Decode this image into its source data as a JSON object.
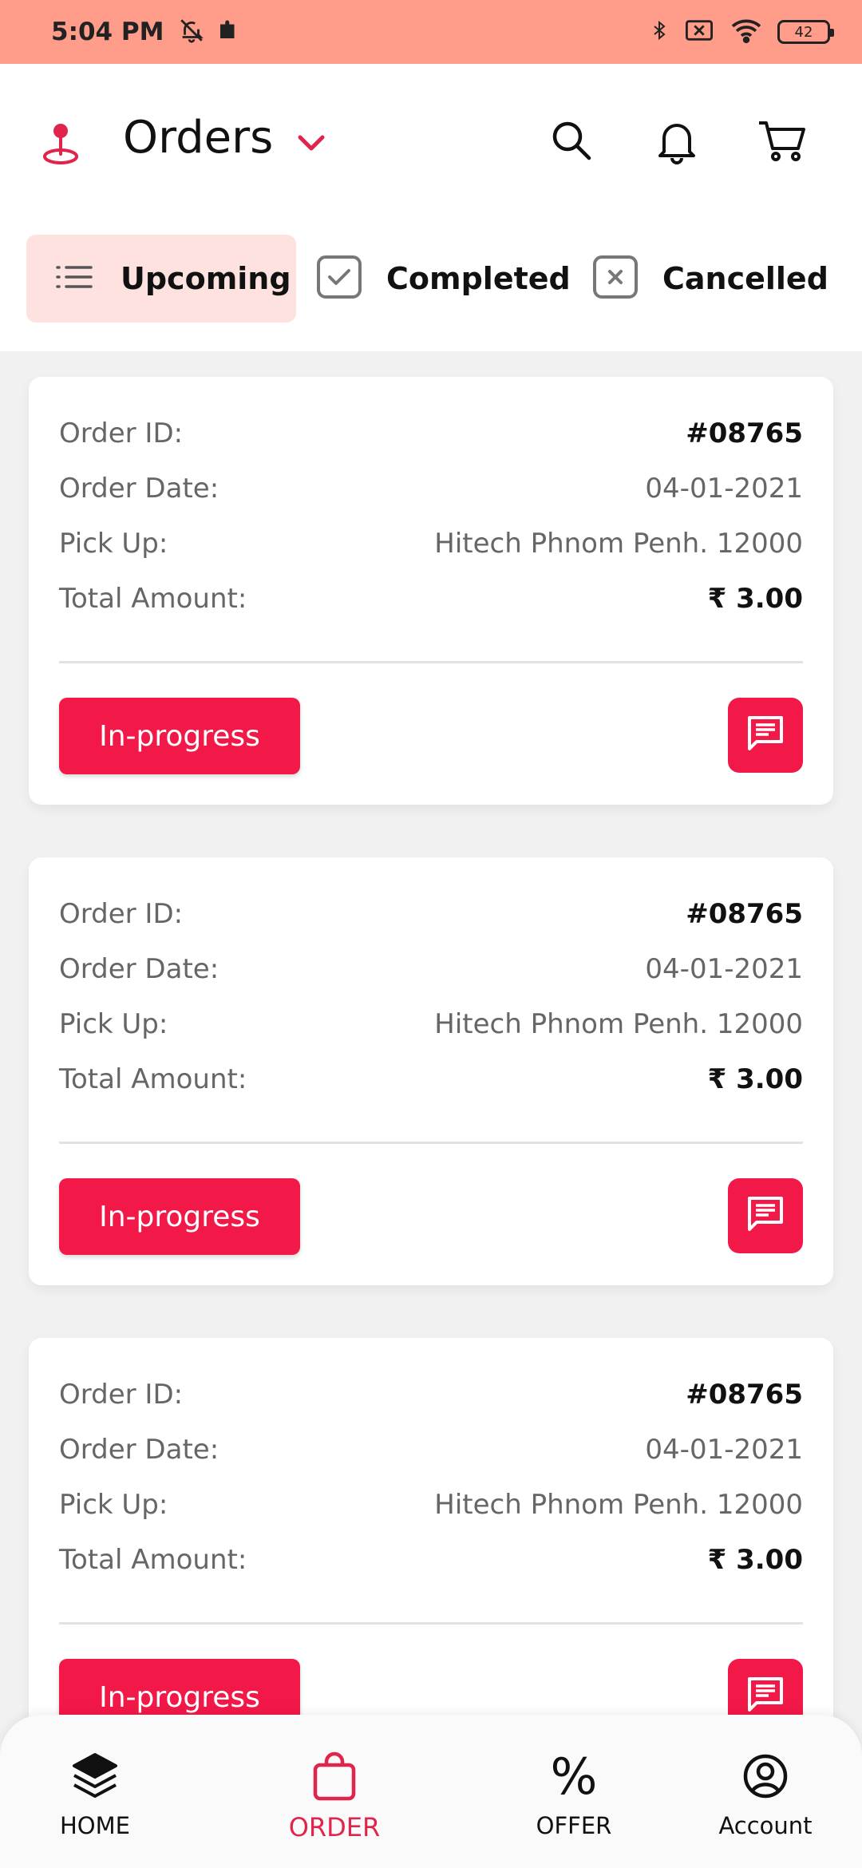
{
  "status_bar": {
    "time": "5:04 PM",
    "battery": "42"
  },
  "header": {
    "title": "Orders"
  },
  "tabs": [
    {
      "label": "Upcoming",
      "active": true
    },
    {
      "label": "Completed",
      "active": false
    },
    {
      "label": "Cancelled",
      "active": false
    }
  ],
  "orders": [
    {
      "id_label": "Order ID:",
      "id": "#08765",
      "date_label": "Order Date:",
      "date": "04-01-2021",
      "pickup_label": "Pick Up:",
      "pickup": "Hitech Phnom Penh. 12000",
      "amount_label": "Total Amount:",
      "amount": "₹ 3.00",
      "status": "In-progress"
    },
    {
      "id_label": "Order ID:",
      "id": "#08765",
      "date_label": "Order Date:",
      "date": "04-01-2021",
      "pickup_label": "Pick Up:",
      "pickup": "Hitech Phnom Penh. 12000",
      "amount_label": "Total Amount:",
      "amount": "₹ 3.00",
      "status": "In-progress"
    },
    {
      "id_label": "Order ID:",
      "id": "#08765",
      "date_label": "Order Date:",
      "date": "04-01-2021",
      "pickup_label": "Pick Up:",
      "pickup": "Hitech Phnom Penh. 12000",
      "amount_label": "Total Amount:",
      "amount": "₹ 3.00",
      "status": "In-progress"
    }
  ],
  "bottom_nav": [
    {
      "label": "HOME",
      "icon": "layers-icon"
    },
    {
      "label": "ORDER",
      "icon": "shopping-bag-icon",
      "active": true
    },
    {
      "label": "OFFER",
      "icon": "percent-icon"
    },
    {
      "label": "Account",
      "icon": "account-circle-icon"
    }
  ],
  "colors": {
    "accent": "#f21848",
    "status_bar": "#ff9c8a",
    "active_tab_bg": "#fde2df"
  }
}
